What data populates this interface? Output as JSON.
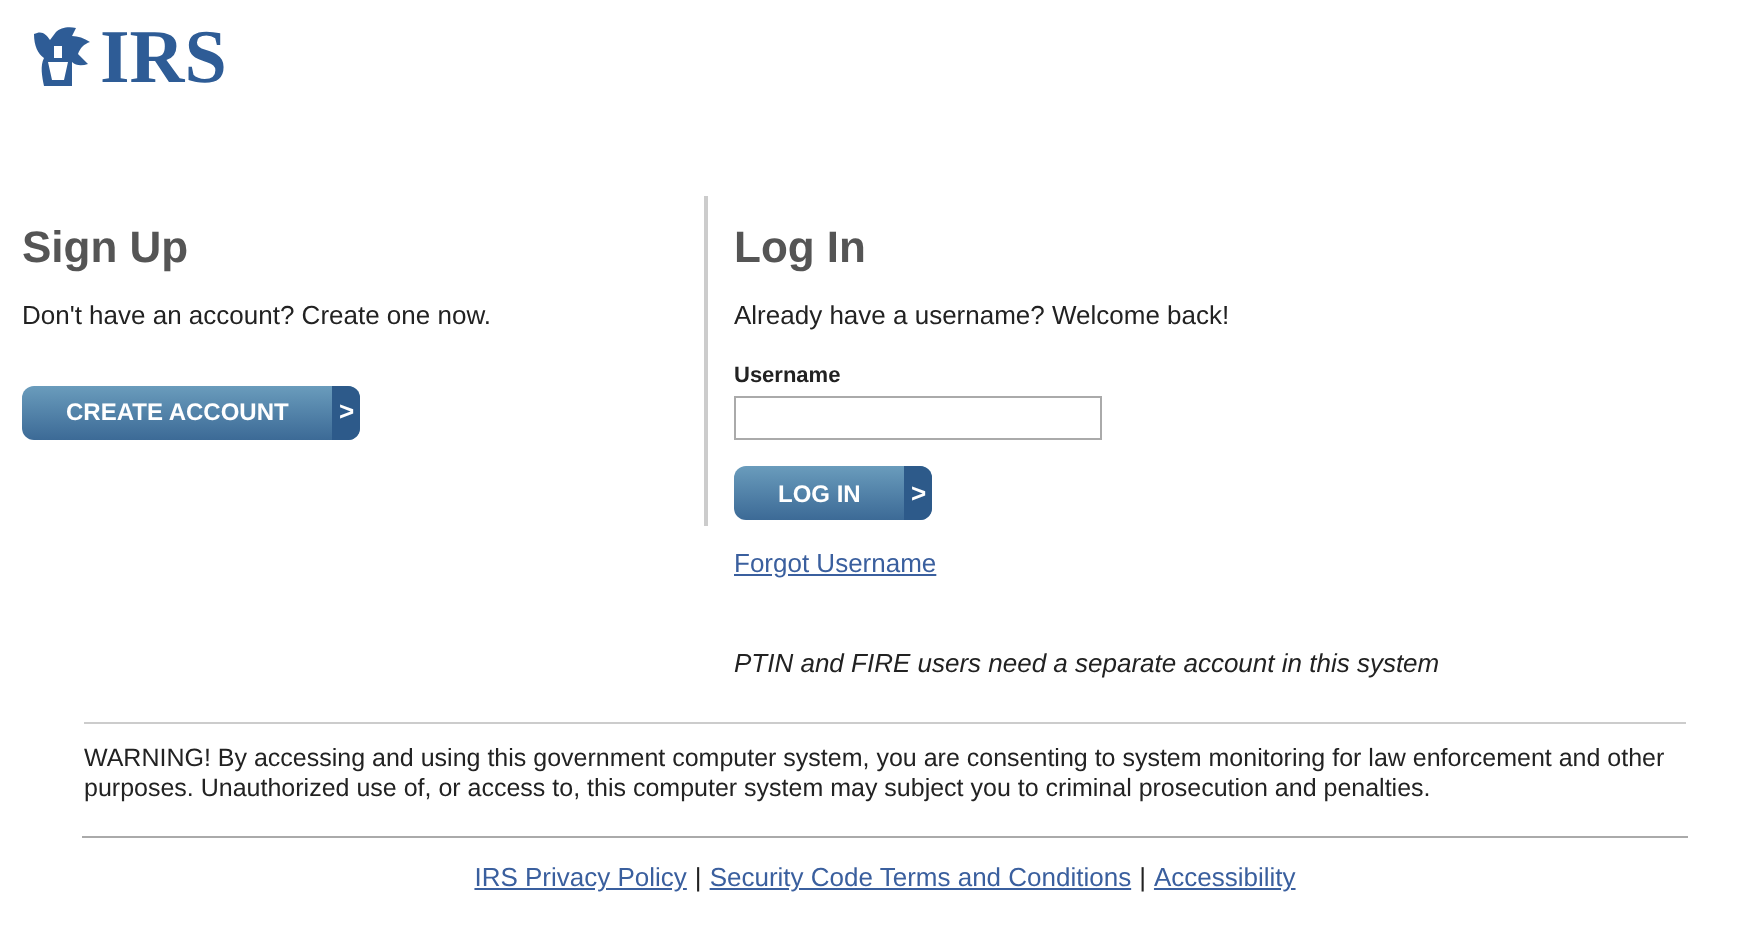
{
  "logo": {
    "text": "IRS"
  },
  "sign_up": {
    "title": "Sign Up",
    "text": "Don't have an account? Create one now.",
    "button": "CREATE ACCOUNT",
    "button_icon": ">"
  },
  "log_in": {
    "title": "Log In",
    "text": "Already have a username? Welcome back!",
    "field_label": "Username",
    "button": "LOG IN",
    "button_icon": ">",
    "forgot_link": "Forgot Username",
    "note": "PTIN and FIRE users need a separate account in this system"
  },
  "warning": "WARNING! By accessing and using this government computer system, you are consenting to system monitoring for law enforcement and other purposes. Unauthorized use of, or access to, this computer system may subject you to criminal prosecution and penalties.",
  "footer_links": [
    {
      "label": "IRS Privacy Policy"
    },
    {
      "label": "Security Code Terms and Conditions"
    },
    {
      "label": "Accessibility"
    }
  ],
  "footer_separator": "|"
}
